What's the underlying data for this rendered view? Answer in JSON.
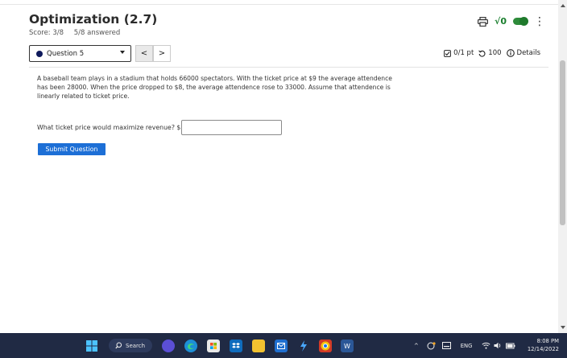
{
  "header": {
    "title": "Optimization (2.7)",
    "score": "Score: 3/8",
    "answered": "5/8 answered",
    "icons": [
      "print-icon",
      "sqrt-icon",
      "toggle-switch",
      "more-vert-icon"
    ],
    "sqrt_glyph": "√0"
  },
  "question_nav": {
    "selected_question": "Question 5",
    "prev_glyph": "<",
    "next_glyph": ">",
    "points": "0/1 pt",
    "attempts": "100",
    "details_label": "Details"
  },
  "question": {
    "text": "A baseball team plays in a stadium that holds 66000 spectators. With the ticket price at $9 the average attendence has been 28000. When the price dropped to $8, the average attendence rose to 33000. Assume that attendence is linearly related to ticket price.",
    "prompt": "What ticket price would maximize revenue? $",
    "answer_value": "",
    "submit_label": "Submit Question"
  },
  "taskbar": {
    "search_label": "Search",
    "language": "ENG",
    "time": "8:08 PM",
    "date": "12/14/2022"
  },
  "colors": {
    "accent": "#1d6fd6",
    "toggle_green": "#2e8b3a",
    "taskbar_bg": "#202a44"
  }
}
